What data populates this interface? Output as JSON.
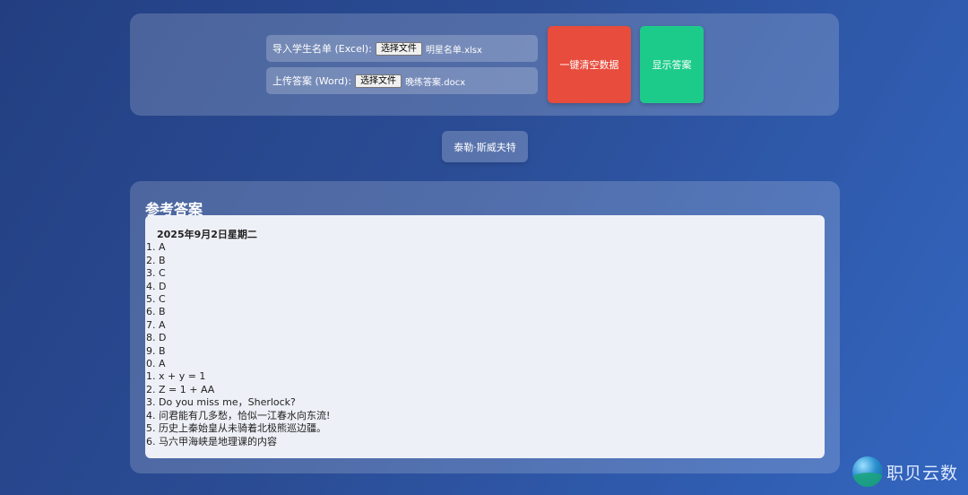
{
  "import_panel": {
    "excel_label": "导入学生名单 (Excel):",
    "excel_button": "选择文件",
    "excel_file": "明星名单.xlsx",
    "word_label": "上传答案 (Word):",
    "word_button": "选择文件",
    "word_file": "晚练答案.docx",
    "clear_button": "一键清空数据",
    "show_button": "显示答案"
  },
  "student": {
    "name": "泰勒·斯威夫特"
  },
  "answers": {
    "title": "参考答案",
    "date": "2025年9月2日星期二",
    "lines": [
      "1. A",
      "2. B",
      "3. C",
      "4. D",
      "5. C",
      "6. B",
      "7. A",
      "8. D",
      "9. B",
      "0. A",
      "1. x + y = 1",
      "2. Z = 1 + AA",
      "3. Do you miss me，Sherlock?",
      "4. 问君能有几多愁，恰似一江春水向东流!",
      "5. 历史上秦始皇从未骑着北极熊巡边疆。",
      "6. 马六甲海峡是地理课的内容"
    ]
  },
  "watermark": {
    "text": "职贝云数",
    "icon": "globe-logo-icon"
  }
}
